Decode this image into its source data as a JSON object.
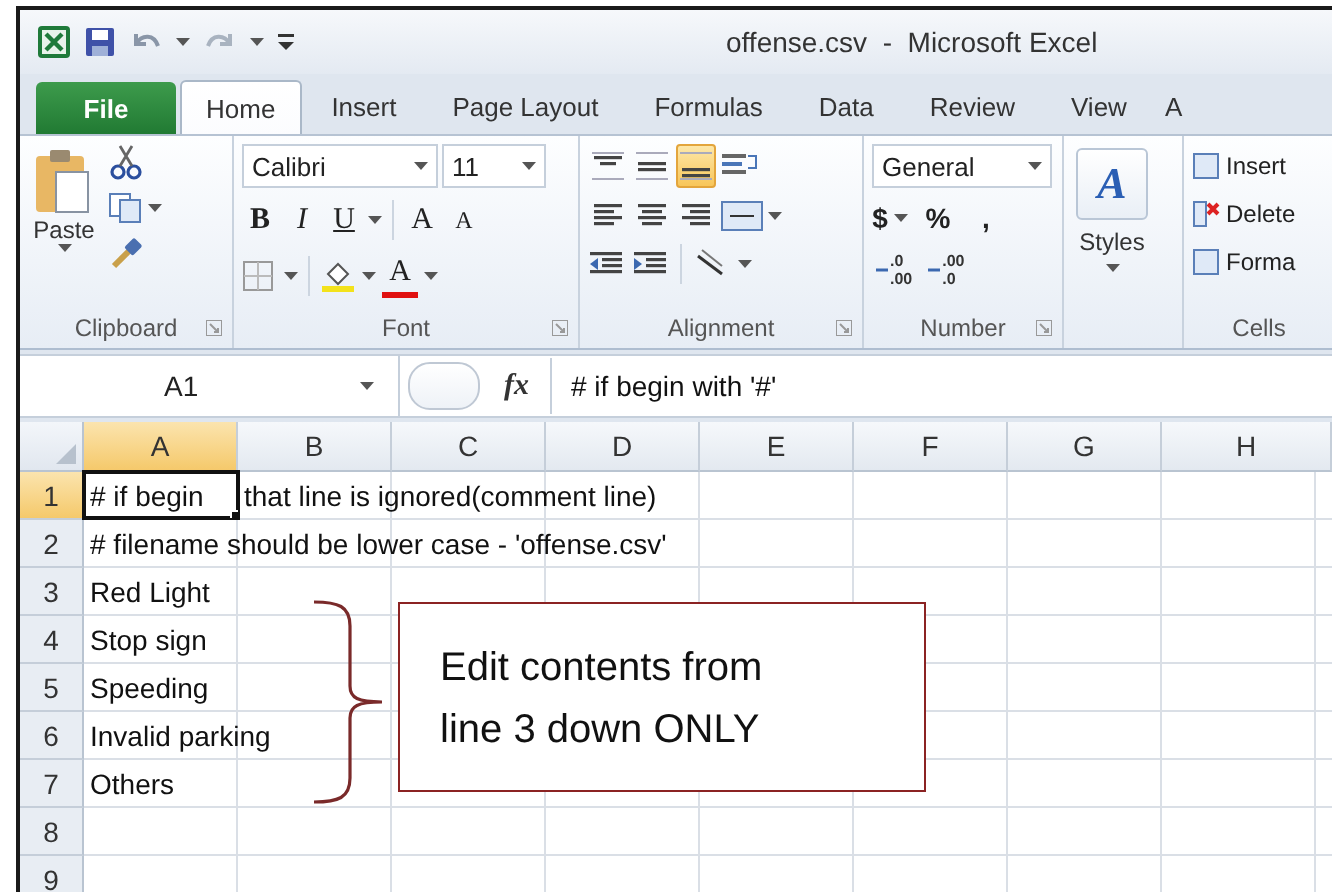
{
  "window": {
    "title": "offense.csv  -  Microsoft Excel"
  },
  "tabs": [
    {
      "label": "File",
      "kind": "file",
      "selected": false
    },
    {
      "label": "Home",
      "kind": "tab",
      "selected": true
    },
    {
      "label": "Insert",
      "kind": "tab",
      "selected": false
    },
    {
      "label": "Page Layout",
      "kind": "tab",
      "selected": false
    },
    {
      "label": "Formulas",
      "kind": "tab",
      "selected": false
    },
    {
      "label": "Data",
      "kind": "tab",
      "selected": false
    },
    {
      "label": "Review",
      "kind": "tab",
      "selected": false
    },
    {
      "label": "View",
      "kind": "tab",
      "selected": false
    },
    {
      "label": "A",
      "kind": "tab",
      "selected": false
    }
  ],
  "ribbon": {
    "clipboard": {
      "paste_label": "Paste",
      "group_label": "Clipboard"
    },
    "font": {
      "font_name": "Calibri",
      "font_size": "11",
      "styles": [
        "B",
        "I",
        "U"
      ],
      "grow": "A",
      "shrink": "A",
      "font_color": "A",
      "group_label": "Font"
    },
    "alignment": {
      "vertical": [
        {
          "selected": false
        },
        {
          "selected": false
        },
        {
          "selected": true
        }
      ],
      "horizontal": [
        {
          "selected": false
        },
        {
          "selected": false
        },
        {
          "selected": false
        }
      ],
      "group_label": "Alignment"
    },
    "number": {
      "format": "General",
      "symbols": [
        "$",
        "%",
        ","
      ],
      "decimals": [
        {
          "top": ".0",
          "bottom": ".00"
        },
        {
          "top": ".00",
          "bottom": ".0"
        }
      ],
      "group_label": "Number"
    },
    "styles": {
      "glyph": "A",
      "label": "Styles"
    },
    "cells": {
      "items": [
        "Insert",
        "Delete",
        "Forma"
      ],
      "group_label": "Cells"
    }
  },
  "formula_bar": {
    "name_box": "A1",
    "fx": "fx",
    "value": "# if begin with '#'"
  },
  "sheet": {
    "columns": [
      {
        "label": "A",
        "selected": true
      },
      {
        "label": "B",
        "selected": false
      },
      {
        "label": "C",
        "selected": false
      },
      {
        "label": "D",
        "selected": false
      },
      {
        "label": "E",
        "selected": false
      },
      {
        "label": "F",
        "selected": false
      },
      {
        "label": "G",
        "selected": false
      },
      {
        "label": "H",
        "selected": false
      }
    ],
    "rows": [
      {
        "label": "1",
        "selected": true,
        "cells": [
          "# if begin",
          "that line is ignored(comment line)"
        ]
      },
      {
        "label": "2",
        "selected": false,
        "cells": [
          "# filename should be lower case - 'offense.csv'"
        ]
      },
      {
        "label": "3",
        "selected": false,
        "cells": [
          "Red Light"
        ]
      },
      {
        "label": "4",
        "selected": false,
        "cells": [
          "Stop sign"
        ]
      },
      {
        "label": "5",
        "selected": false,
        "cells": [
          "Speeding"
        ]
      },
      {
        "label": "6",
        "selected": false,
        "cells": [
          "Invalid parking"
        ]
      },
      {
        "label": "7",
        "selected": false,
        "cells": [
          "Others"
        ]
      },
      {
        "label": "8",
        "selected": false
      },
      {
        "label": "9",
        "selected": false
      }
    ]
  },
  "callout": {
    "lines": [
      "Edit contents from",
      "line 3 down ONLY"
    ]
  }
}
